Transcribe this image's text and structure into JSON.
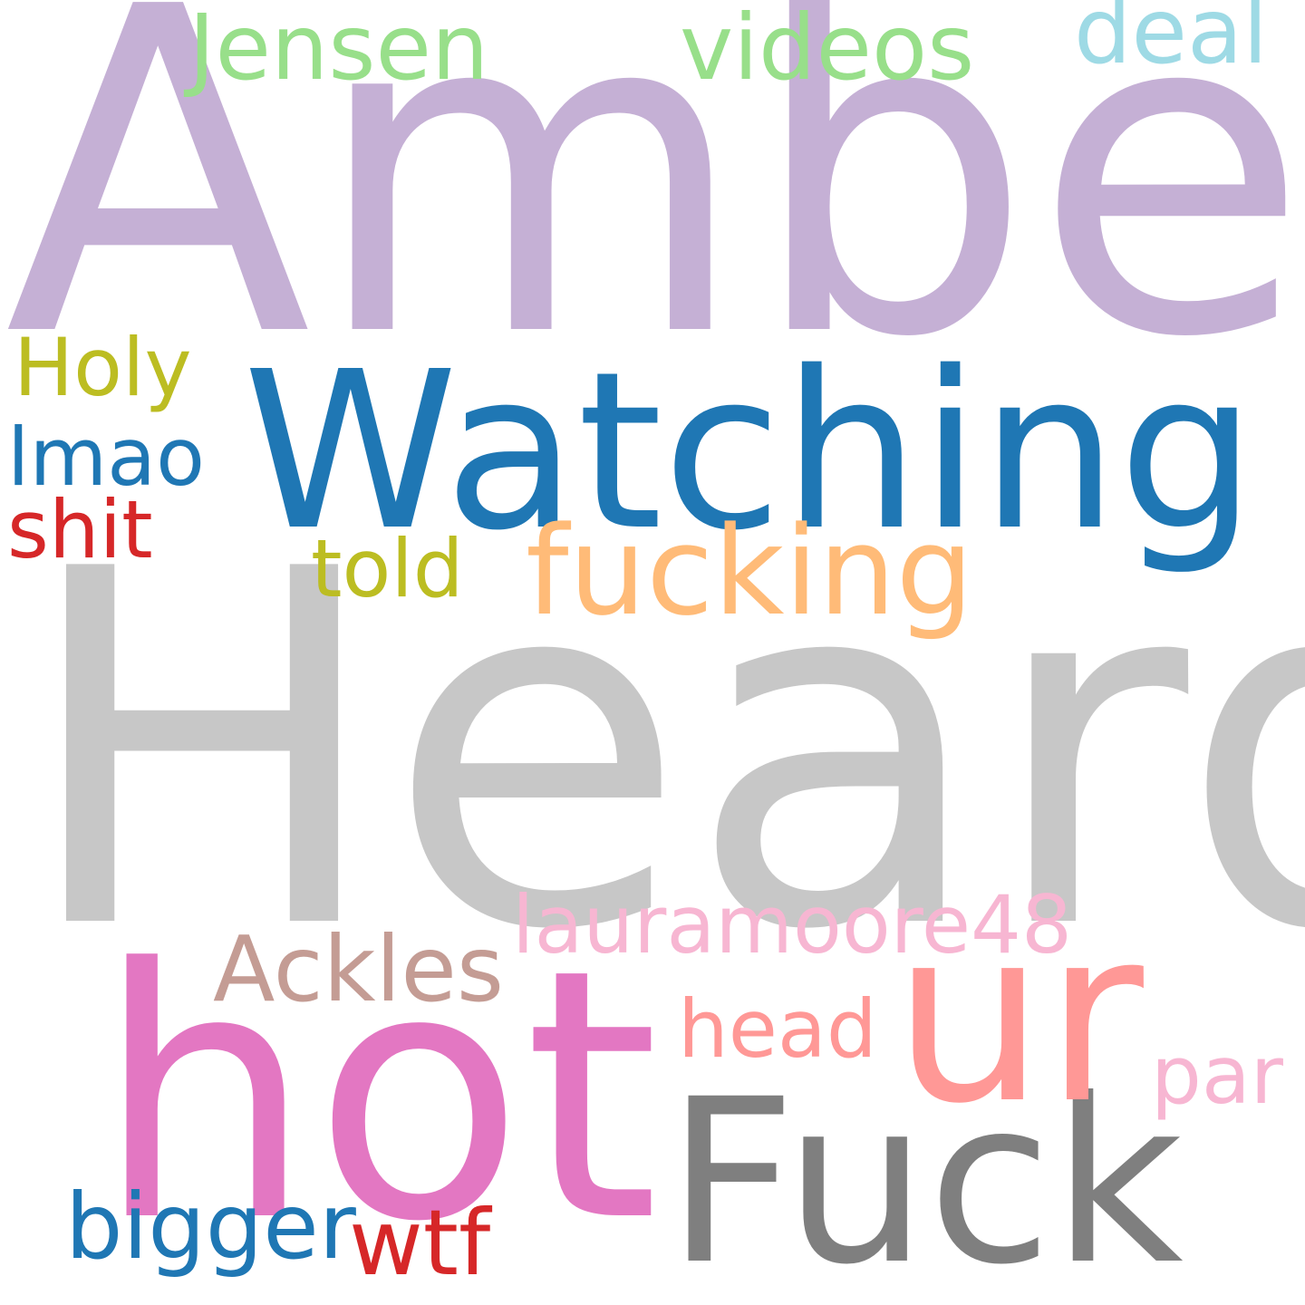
{
  "word_cloud": {
    "words": [
      {
        "text": "Amber",
        "color": "#c5b0d5"
      },
      {
        "text": "Heard",
        "color": "#c7c7c7"
      },
      {
        "text": "Watching",
        "color": "#1f77b4"
      },
      {
        "text": "hot",
        "color": "#e377c2"
      },
      {
        "text": "Fuck",
        "color": "#7f7f7f"
      },
      {
        "text": "ur",
        "color": "#ff9896"
      },
      {
        "text": "fucking",
        "color": "#ffbb78"
      },
      {
        "text": "Jensen",
        "color": "#98df8a"
      },
      {
        "text": "videos",
        "color": "#98df8a"
      },
      {
        "text": "deal",
        "color": "#9edae5"
      },
      {
        "text": "Holy",
        "color": "#bcbd22"
      },
      {
        "text": "lmao",
        "color": "#1f77b4"
      },
      {
        "text": "shit",
        "color": "#d62728"
      },
      {
        "text": "told",
        "color": "#bcbd22"
      },
      {
        "text": "lauramoore48",
        "color": "#f7b6d2"
      },
      {
        "text": "Ackles",
        "color": "#c49c94"
      },
      {
        "text": "head",
        "color": "#ff9896"
      },
      {
        "text": "par",
        "color": "#f7b6d2"
      },
      {
        "text": "bigger",
        "color": "#1f77b4"
      },
      {
        "text": "wtf",
        "color": "#d62728"
      }
    ]
  }
}
